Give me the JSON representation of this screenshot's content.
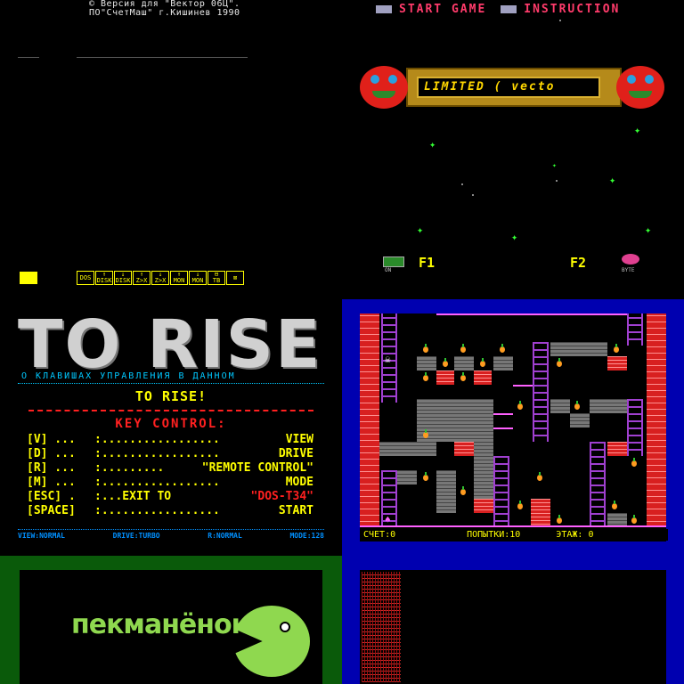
{
  "pane_credits": {
    "line1": "©  Версия для \"Вектор 06Ц\".",
    "line2": "ПО\"СчетМаш\" г.Кишинев  1990",
    "fkeys": [
      {
        "top": "DOS",
        "bottom": ""
      },
      {
        "top": "↑",
        "bottom": "DISK"
      },
      {
        "top": "↓",
        "bottom": "DISK"
      },
      {
        "top": "↑",
        "bottom": "Z>X"
      },
      {
        "top": "↓",
        "bottom": "Z>X"
      },
      {
        "top": "↑",
        "bottom": "MON"
      },
      {
        "top": "↓",
        "bottom": "MON"
      },
      {
        "top": "⊟",
        "bottom": "TB"
      },
      {
        "top": "⊠",
        "bottom": ""
      }
    ]
  },
  "pane_menu": {
    "start_label": "START GAME",
    "instruction_label": "INSTRUCTION",
    "banner_text": "LIMITED ( vecto",
    "f1_label": "F1",
    "f2_label": "F2",
    "f1_sub": "ON",
    "f2_sub": "BYTE",
    "colors": {
      "menu": "#ff3b6b",
      "stars": "#33ff33",
      "banner": "#b58a1a"
    }
  },
  "pane_torise": {
    "logo": "TO RISE",
    "subtitle": "О КЛАВИШАХ УПРАВЛЕНИЯ В ДАННОМ",
    "title": "TO RISE!",
    "key_control": "KEY CONTROL:",
    "rows": [
      {
        "key": "[V] ...",
        "dots": ":.................",
        "value": "VIEW",
        "red": false
      },
      {
        "key": "[D] ...",
        "dots": ":.................",
        "value": "DRIVE",
        "red": false
      },
      {
        "key": "[R] ...",
        "dots": ":.........",
        "value": "\"REMOTE CONTROL\"",
        "red": false
      },
      {
        "key": "[M] ...",
        "dots": ":.................",
        "value": "MODE",
        "red": false
      },
      {
        "key": "[ESC] .",
        "dots": ":...EXIT TO",
        "value": "\"DOS-T34\"",
        "red": true
      },
      {
        "key": "[SPACE]",
        "dots": ":.................",
        "value": "START",
        "red": false
      }
    ],
    "status": [
      "VIEW:NORMAL",
      "DRIVE:TURBO",
      "R:NORMAL",
      "MODE:128"
    ]
  },
  "pane_game": {
    "score_label": "СЧЕТ:0",
    "tries_label": "ПОПЫТКИ:10",
    "floor_label": "ЭТАЖ: 0"
  },
  "pane_pek": {
    "word": "пекманёнок"
  }
}
